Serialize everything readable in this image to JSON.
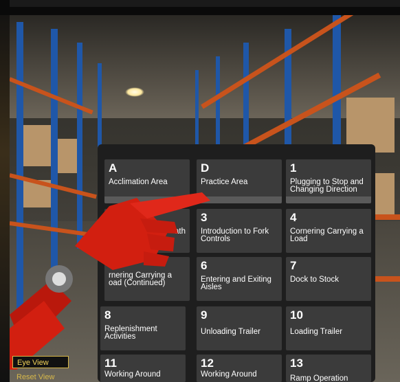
{
  "menu": {
    "tiles": [
      {
        "letter": "A",
        "name": "Acclimation Area"
      },
      {
        "letter": "D",
        "name": "Practice Area"
      },
      {
        "letter": "1",
        "name": "Plugging to Stop and Changing Direction"
      },
      {
        "letter": "",
        "name": "ath"
      },
      {
        "letter": "3",
        "name": "Introduction to Fork Controls"
      },
      {
        "letter": "4",
        "name": "Cornering Carrying a Load"
      },
      {
        "letter": "",
        "name": "rnering Carrying a oad (Continued)"
      },
      {
        "letter": "6",
        "name": "Entering and Exiting Aisles"
      },
      {
        "letter": "7",
        "name": "Dock to Stock"
      },
      {
        "letter": "8",
        "name": "Replenishment Activities"
      },
      {
        "letter": "9",
        "name": "Unloading Trailer"
      },
      {
        "letter": "10",
        "name": "Loading Trailer"
      },
      {
        "letter": "11",
        "name": "Working Around"
      },
      {
        "letter": "12",
        "name": "Working Around"
      },
      {
        "letter": "13",
        "name": "Ramp Operation"
      }
    ]
  },
  "view_controls": {
    "eye_view": "Eye View",
    "reset_view": "Reset View"
  },
  "colors": {
    "rack": "#1f57a8",
    "beam": "#c8531c",
    "tile": "#3b3b3b",
    "accent": "#d8b94a",
    "hand": "#d21f10"
  }
}
